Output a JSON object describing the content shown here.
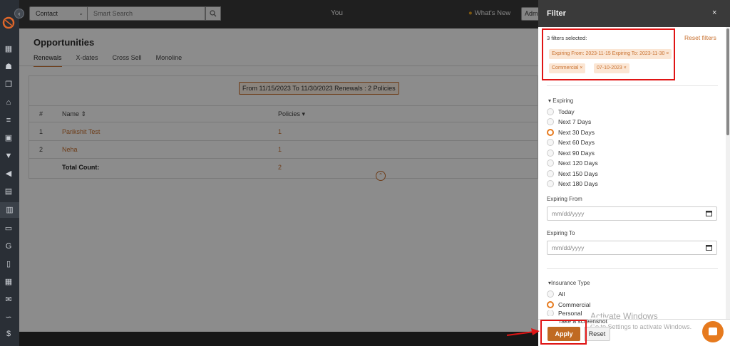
{
  "topbar": {
    "contact_select": "Contact",
    "search_placeholder": "Smart Search",
    "title": "You",
    "whats_new": "What's New",
    "admin": "Admin"
  },
  "page": {
    "title": "Opportunities",
    "tabs": [
      {
        "label": "Renewals",
        "active": true
      },
      {
        "label": "X-dates",
        "active": false
      },
      {
        "label": "Cross Sell",
        "active": false
      },
      {
        "label": "Monoline",
        "active": false
      }
    ],
    "summary": "From 11/15/2023 To 11/30/2023 Renewals : 2 Policies",
    "table": {
      "headers": [
        "#",
        "Name ⇕",
        "Policies ▾"
      ],
      "rows": [
        {
          "num": "1",
          "name": "Parikshit Test",
          "policies": "1"
        },
        {
          "num": "2",
          "name": "Neha",
          "policies": "1"
        }
      ],
      "total_label": "Total Count:",
      "total_value": "2"
    }
  },
  "filter": {
    "title": "Filter",
    "close": "×",
    "selected_count": "3 filters selected:",
    "reset_filters": "Reset filters",
    "chips": [
      "Expiring From: 2023-11-15 Expiring To: 2023-11-30 ×",
      "Commercial ×",
      "07-10-2023 ×"
    ],
    "expiring": {
      "label": "▾ Expiring",
      "options": [
        "Today",
        "Next 7 Days",
        "Next 30 Days",
        "Next 60 Days",
        "Next 90 Days",
        "Next 120 Days",
        "Next 150 Days",
        "Next 180 Days"
      ],
      "selected": "Next 30 Days"
    },
    "expiring_from": {
      "label": "Expiring From",
      "placeholder": "mm/dd/yyyy"
    },
    "expiring_to": {
      "label": "Expiring To",
      "placeholder": "mm/dd/yyyy"
    },
    "insurance_type": {
      "label": "▾Insurance Type",
      "options": [
        "All",
        "Commercial",
        "Personal"
      ],
      "selected": "Commercial"
    },
    "apply_label": "Apply",
    "reset_label": "Reset"
  },
  "system": {
    "screenshot_tip": "Take a screenshot",
    "activate_title": "Activate Windows",
    "activate_sub": "Go to Settings to activate Windows."
  },
  "colors": {
    "accent": "#c8702e",
    "highlight_red": "#e01414",
    "sidebar": "#2a2f36",
    "topbar": "#3a3a3a"
  }
}
